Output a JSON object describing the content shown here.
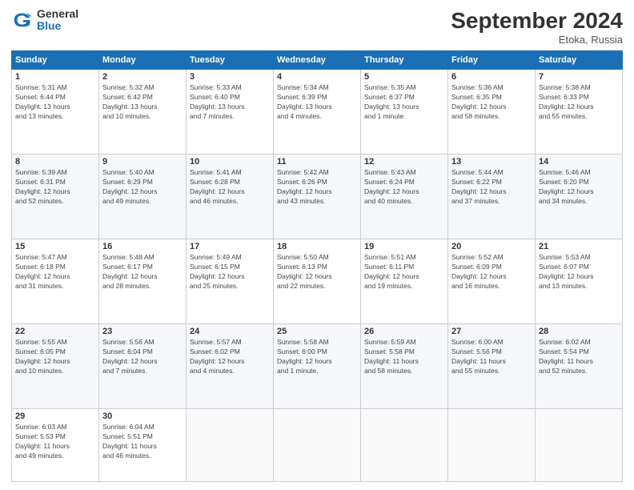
{
  "header": {
    "logo_general": "General",
    "logo_blue": "Blue",
    "month": "September 2024",
    "location": "Etoka, Russia"
  },
  "days_of_week": [
    "Sunday",
    "Monday",
    "Tuesday",
    "Wednesday",
    "Thursday",
    "Friday",
    "Saturday"
  ],
  "weeks": [
    [
      {
        "day": "1",
        "info": "Sunrise: 5:31 AM\nSunset: 6:44 PM\nDaylight: 13 hours\nand 13 minutes."
      },
      {
        "day": "2",
        "info": "Sunrise: 5:32 AM\nSunset: 6:42 PM\nDaylight: 13 hours\nand 10 minutes."
      },
      {
        "day": "3",
        "info": "Sunrise: 5:33 AM\nSunset: 6:40 PM\nDaylight: 13 hours\nand 7 minutes."
      },
      {
        "day": "4",
        "info": "Sunrise: 5:34 AM\nSunset: 6:39 PM\nDaylight: 13 hours\nand 4 minutes."
      },
      {
        "day": "5",
        "info": "Sunrise: 5:35 AM\nSunset: 6:37 PM\nDaylight: 13 hours\nand 1 minute."
      },
      {
        "day": "6",
        "info": "Sunrise: 5:36 AM\nSunset: 6:35 PM\nDaylight: 12 hours\nand 58 minutes."
      },
      {
        "day": "7",
        "info": "Sunrise: 5:38 AM\nSunset: 6:33 PM\nDaylight: 12 hours\nand 55 minutes."
      }
    ],
    [
      {
        "day": "8",
        "info": "Sunrise: 5:39 AM\nSunset: 6:31 PM\nDaylight: 12 hours\nand 52 minutes."
      },
      {
        "day": "9",
        "info": "Sunrise: 5:40 AM\nSunset: 6:29 PM\nDaylight: 12 hours\nand 49 minutes."
      },
      {
        "day": "10",
        "info": "Sunrise: 5:41 AM\nSunset: 6:28 PM\nDaylight: 12 hours\nand 46 minutes."
      },
      {
        "day": "11",
        "info": "Sunrise: 5:42 AM\nSunset: 6:26 PM\nDaylight: 12 hours\nand 43 minutes."
      },
      {
        "day": "12",
        "info": "Sunrise: 5:43 AM\nSunset: 6:24 PM\nDaylight: 12 hours\nand 40 minutes."
      },
      {
        "day": "13",
        "info": "Sunrise: 5:44 AM\nSunset: 6:22 PM\nDaylight: 12 hours\nand 37 minutes."
      },
      {
        "day": "14",
        "info": "Sunrise: 5:46 AM\nSunset: 6:20 PM\nDaylight: 12 hours\nand 34 minutes."
      }
    ],
    [
      {
        "day": "15",
        "info": "Sunrise: 5:47 AM\nSunset: 6:18 PM\nDaylight: 12 hours\nand 31 minutes."
      },
      {
        "day": "16",
        "info": "Sunrise: 5:48 AM\nSunset: 6:17 PM\nDaylight: 12 hours\nand 28 minutes."
      },
      {
        "day": "17",
        "info": "Sunrise: 5:49 AM\nSunset: 6:15 PM\nDaylight: 12 hours\nand 25 minutes."
      },
      {
        "day": "18",
        "info": "Sunrise: 5:50 AM\nSunset: 6:13 PM\nDaylight: 12 hours\nand 22 minutes."
      },
      {
        "day": "19",
        "info": "Sunrise: 5:51 AM\nSunset: 6:11 PM\nDaylight: 12 hours\nand 19 minutes."
      },
      {
        "day": "20",
        "info": "Sunrise: 5:52 AM\nSunset: 6:09 PM\nDaylight: 12 hours\nand 16 minutes."
      },
      {
        "day": "21",
        "info": "Sunrise: 5:53 AM\nSunset: 6:07 PM\nDaylight: 12 hours\nand 13 minutes."
      }
    ],
    [
      {
        "day": "22",
        "info": "Sunrise: 5:55 AM\nSunset: 6:05 PM\nDaylight: 12 hours\nand 10 minutes."
      },
      {
        "day": "23",
        "info": "Sunrise: 5:56 AM\nSunset: 6:04 PM\nDaylight: 12 hours\nand 7 minutes."
      },
      {
        "day": "24",
        "info": "Sunrise: 5:57 AM\nSunset: 6:02 PM\nDaylight: 12 hours\nand 4 minutes."
      },
      {
        "day": "25",
        "info": "Sunrise: 5:58 AM\nSunset: 6:00 PM\nDaylight: 12 hours\nand 1 minute."
      },
      {
        "day": "26",
        "info": "Sunrise: 5:59 AM\nSunset: 5:58 PM\nDaylight: 11 hours\nand 58 minutes."
      },
      {
        "day": "27",
        "info": "Sunrise: 6:00 AM\nSunset: 5:56 PM\nDaylight: 11 hours\nand 55 minutes."
      },
      {
        "day": "28",
        "info": "Sunrise: 6:02 AM\nSunset: 5:54 PM\nDaylight: 11 hours\nand 52 minutes."
      }
    ],
    [
      {
        "day": "29",
        "info": "Sunrise: 6:03 AM\nSunset: 5:53 PM\nDaylight: 11 hours\nand 49 minutes."
      },
      {
        "day": "30",
        "info": "Sunrise: 6:04 AM\nSunset: 5:51 PM\nDaylight: 11 hours\nand 46 minutes."
      },
      {
        "day": "",
        "info": ""
      },
      {
        "day": "",
        "info": ""
      },
      {
        "day": "",
        "info": ""
      },
      {
        "day": "",
        "info": ""
      },
      {
        "day": "",
        "info": ""
      }
    ]
  ]
}
